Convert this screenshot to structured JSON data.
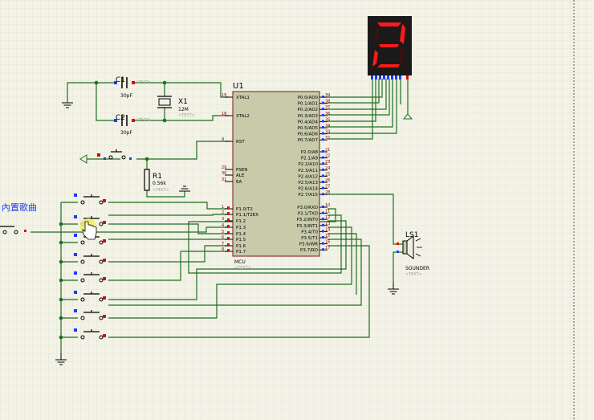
{
  "colors": {
    "background": "#f2f2e6",
    "grid": "#dcdcca",
    "wire": "#1e6e1e",
    "component": "#000000",
    "ic_fill": "#c8caaa",
    "ic_border": "#7a1a1a",
    "pin_number": "#8a0000",
    "pin_red": "#e00000",
    "pin_blue": "#1a3cff",
    "seg_bg": "#1a1a1a",
    "seg_on": "#ff1a1a",
    "text_placeholder": "#a0a0a0",
    "label_blue": "#1a3cff"
  },
  "display": {
    "digit": "2",
    "segments_on": [
      true,
      true,
      false,
      true,
      true,
      false,
      true
    ]
  },
  "title_label": "內置歌曲",
  "mcu": {
    "ref": "U1",
    "name": "MCU",
    "text_tag": "<TEXT>",
    "left_pins": [
      {
        "num": "19",
        "name": "XTAL1"
      },
      {
        "num": "18",
        "name": "XTAL2"
      },
      {
        "num": "9",
        "name": "RST"
      },
      {
        "num": "29",
        "name": "PSEN"
      },
      {
        "num": "30",
        "name": "ALE"
      },
      {
        "num": "31",
        "name": "EA"
      },
      {
        "num": "1",
        "name": "P1.0/T2"
      },
      {
        "num": "2",
        "name": "P1.1/T2EX"
      },
      {
        "num": "3",
        "name": "P1.2"
      },
      {
        "num": "4",
        "name": "P1.3"
      },
      {
        "num": "5",
        "name": "P1.4"
      },
      {
        "num": "6",
        "name": "P1.5"
      },
      {
        "num": "7",
        "name": "P1.6"
      },
      {
        "num": "8",
        "name": "P1.7"
      }
    ],
    "right_pins_p0": [
      {
        "num": "39",
        "name": "P0.0/AD0"
      },
      {
        "num": "38",
        "name": "P0.1/AD1"
      },
      {
        "num": "37",
        "name": "P0.2/AD2"
      },
      {
        "num": "36",
        "name": "P0.3/AD3"
      },
      {
        "num": "35",
        "name": "P0.4/AD4"
      },
      {
        "num": "34",
        "name": "P0.5/AD5"
      },
      {
        "num": "33",
        "name": "P0.6/AD6"
      },
      {
        "num": "32",
        "name": "P0.7/AD7"
      }
    ],
    "right_pins_p2": [
      {
        "num": "21",
        "name": "P2.0/A8"
      },
      {
        "num": "22",
        "name": "P2.1/A9"
      },
      {
        "num": "23",
        "name": "P2.2/A10"
      },
      {
        "num": "24",
        "name": "P2.3/A11"
      },
      {
        "num": "25",
        "name": "P2.4/A12"
      },
      {
        "num": "26",
        "name": "P2.5/A13"
      },
      {
        "num": "27",
        "name": "P2.6/A14"
      },
      {
        "num": "28",
        "name": "P2.7/A15"
      }
    ],
    "right_pins_p3": [
      {
        "num": "10",
        "name": "P3.0/RXD"
      },
      {
        "num": "11",
        "name": "P3.1/TXD"
      },
      {
        "num": "12",
        "name": "P3.2/INT0"
      },
      {
        "num": "13",
        "name": "P3.3/INT1"
      },
      {
        "num": "14",
        "name": "P3.4/T0"
      },
      {
        "num": "15",
        "name": "P3.5/T1"
      },
      {
        "num": "16",
        "name": "P3.6/WR"
      },
      {
        "num": "17",
        "name": "P3.7/RD"
      }
    ]
  },
  "c1": {
    "ref": "C1",
    "value": "30pF",
    "tag": "<TEXT>"
  },
  "c2": {
    "ref": "C2",
    "value": "30pF",
    "tag": "<TEXT>"
  },
  "x1": {
    "ref": "X1",
    "value": "12M",
    "tag": "<TEXT>"
  },
  "r1": {
    "ref": "R1",
    "value": "0.56k",
    "tag": "<TEXT>"
  },
  "ls1": {
    "ref": "LS1",
    "name": "SOUNDER",
    "tag": "<TEXT>"
  }
}
